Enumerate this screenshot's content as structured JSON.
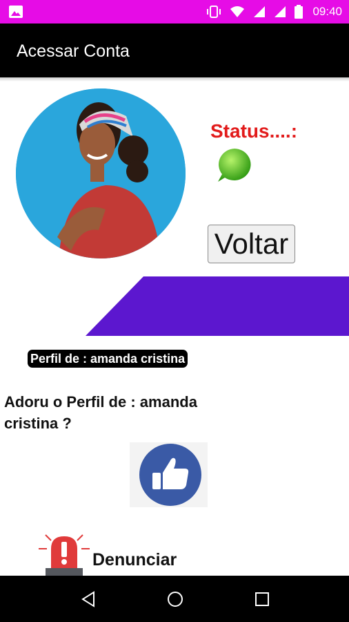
{
  "status_bar": {
    "time": "09:40",
    "icons": [
      "gallery-icon",
      "vibrate-icon",
      "wifi-icon",
      "signal-icon",
      "signal-icon",
      "battery-icon"
    ],
    "background": "#e60ce6"
  },
  "app_bar": {
    "title": "Acessar Conta",
    "background": "#000000"
  },
  "profile": {
    "status_label": "Status....:",
    "status_icon": "online-bubble-icon",
    "back_button": "Voltar",
    "profile_name_label": "Perfil de : amanda cristina",
    "like_question": "Adoru o Perfil de : amanda cristina ?",
    "like_icon": "thumbs-up-icon",
    "report_label": "Denunciar",
    "report_icon": "siren-alert-icon"
  },
  "colors": {
    "status_text": "#e21b1b",
    "purple_band": "#5c17cf",
    "like_circle": "#3a5aa6"
  },
  "nav_bar": {
    "buttons": [
      "back-icon",
      "home-icon",
      "recents-icon"
    ]
  }
}
